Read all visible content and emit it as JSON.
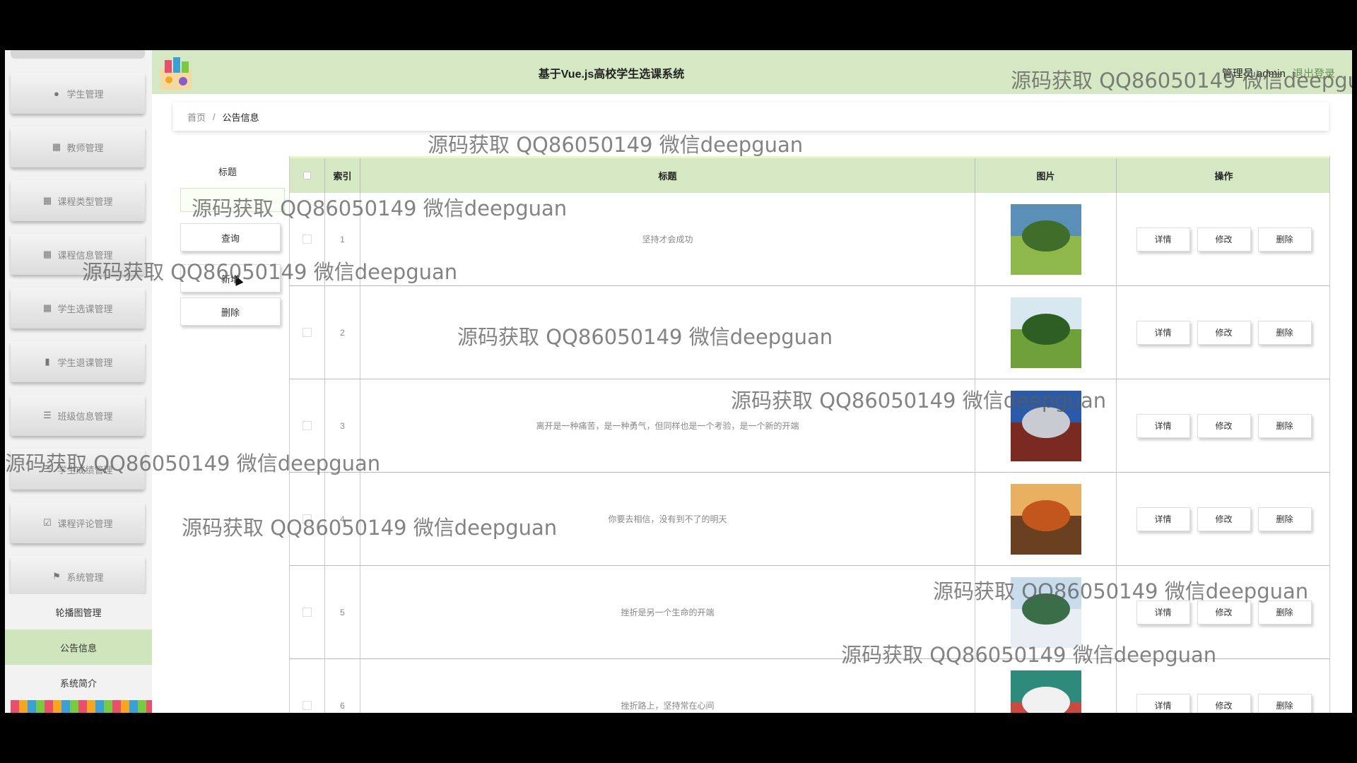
{
  "app": {
    "title": "基于Vue.js高校学生选课系统",
    "admin_text": "管理员 admin",
    "logout_label": "退出登录"
  },
  "sidebar": {
    "menu": [
      {
        "label": "学生管理",
        "icon": "user-icon"
      },
      {
        "label": "教师管理",
        "icon": "grid-icon"
      },
      {
        "label": "课程类型管理",
        "icon": "grid-icon"
      },
      {
        "label": "课程信息管理",
        "icon": "grid-icon"
      },
      {
        "label": "学生选课管理",
        "icon": "grid-icon"
      },
      {
        "label": "学生退课管理",
        "icon": "bar-chart-icon"
      },
      {
        "label": "班级信息管理",
        "icon": "list-icon"
      },
      {
        "label": "学生成绩管理",
        "icon": "list-icon"
      },
      {
        "label": "课程评论管理",
        "icon": "check-square-icon"
      },
      {
        "label": "系统管理",
        "icon": "flag-icon"
      }
    ],
    "sub_items": [
      {
        "label": "轮播图管理",
        "active": false
      },
      {
        "label": "公告信息",
        "active": true
      },
      {
        "label": "系统简介",
        "active": false
      }
    ]
  },
  "breadcrumb": {
    "home": "首页",
    "separator": "/",
    "current": "公告信息"
  },
  "search": {
    "label": "标题",
    "value": "",
    "query_button": "查询",
    "add_button": "新增",
    "delete_button": "删除"
  },
  "table": {
    "headers": {
      "index": "索引",
      "title": "标题",
      "image": "图片",
      "actions": "操作"
    },
    "action_labels": {
      "detail": "详情",
      "edit": "修改",
      "delete": "删除"
    },
    "rows": [
      {
        "index": "1",
        "title": "坚持才会成功",
        "image_colors": [
          "#5a8fb8",
          "#3f6e2a",
          "#8fb84a"
        ]
      },
      {
        "index": "2",
        "title": "",
        "image_colors": [
          "#d8e8f0",
          "#2f5e25",
          "#6fa03a"
        ]
      },
      {
        "index": "3",
        "title": "离开是一种痛苦，是一种勇气，但同样也是一个考验，是一个新的开端",
        "image_colors": [
          "#2a5aa8",
          "#c8ccd2",
          "#7a2a20"
        ]
      },
      {
        "index": "4",
        "title": "你要去相信，没有到不了的明天",
        "image_colors": [
          "#e8b060",
          "#c2561c",
          "#6a4020"
        ]
      },
      {
        "index": "5",
        "title": "挫折是另一个生命的开端",
        "image_colors": [
          "#c8dcec",
          "#3a6e48",
          "#e8eef4"
        ]
      },
      {
        "index": "6",
        "title": "挫折路上，坚持常在心间",
        "image_colors": [
          "#2e8a7a",
          "#f0f0f0",
          "#c84a40"
        ]
      }
    ]
  },
  "watermark": "源码获取 QQ86050149 微信deepguan"
}
